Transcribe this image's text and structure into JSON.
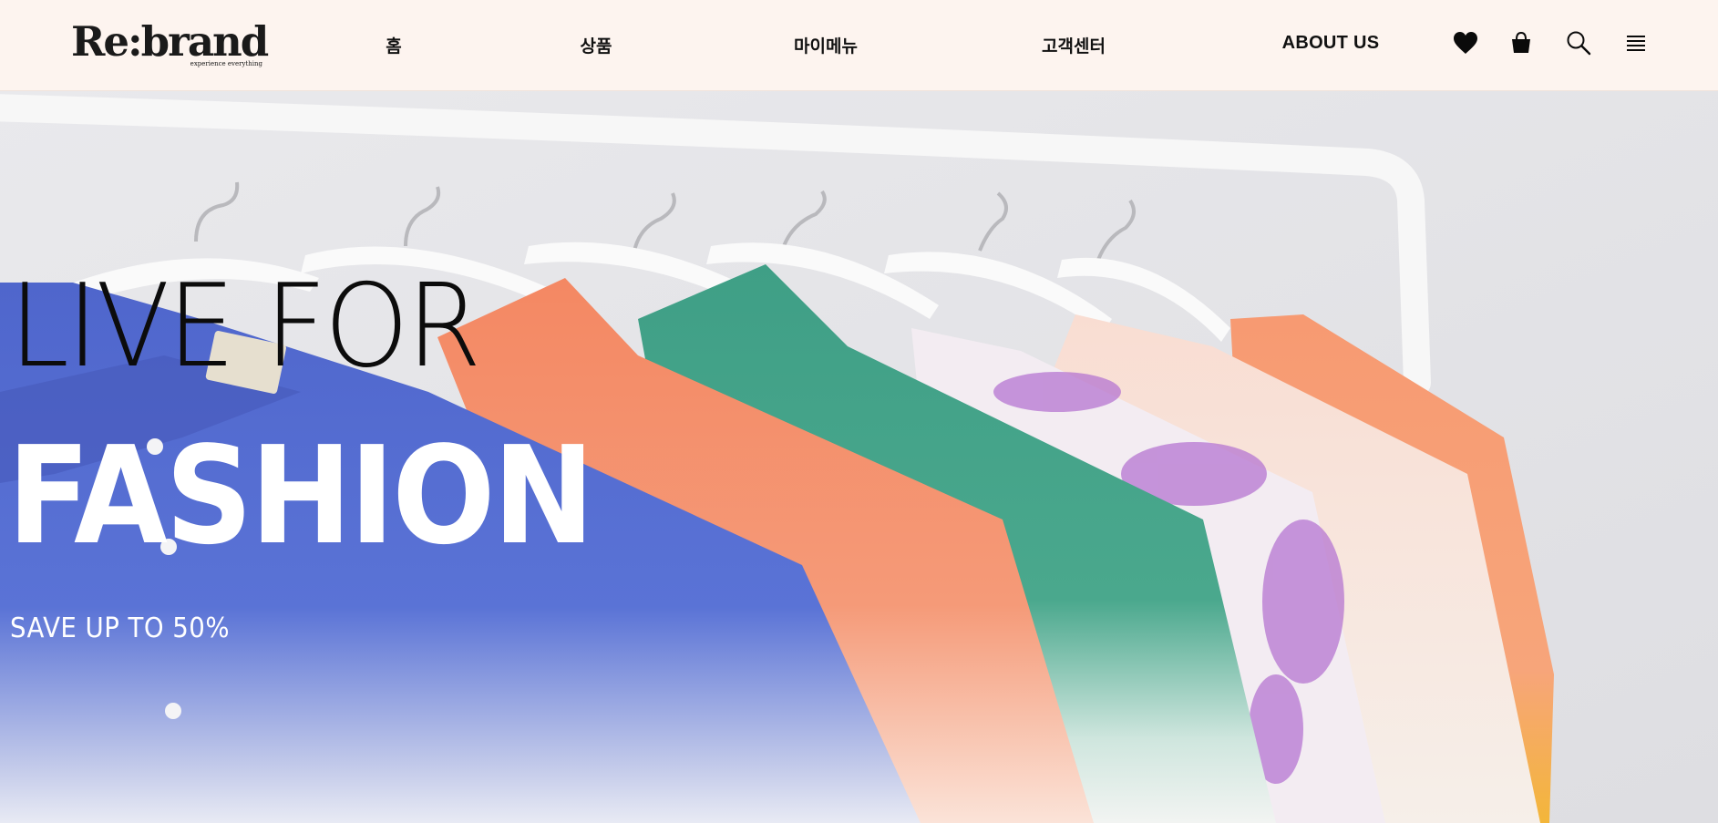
{
  "header": {
    "logo": {
      "text": "Re:brand",
      "tagline": "experience everything"
    },
    "nav": {
      "home": "홈",
      "products": "상품",
      "mymenu": "마이메뉴",
      "support": "고객센터",
      "about": "ABOUT US"
    },
    "icons": [
      "heart-icon",
      "shopping-bag-icon",
      "search-icon",
      "menu-icon"
    ]
  },
  "hero": {
    "line1": "LIVE FOR",
    "line2": "FASHION",
    "line3": "SAVE UP TO 50%"
  },
  "colors": {
    "header_bg": "#fdf4ef",
    "text_dark": "#0c0c0c",
    "text_light": "#ffffff"
  }
}
